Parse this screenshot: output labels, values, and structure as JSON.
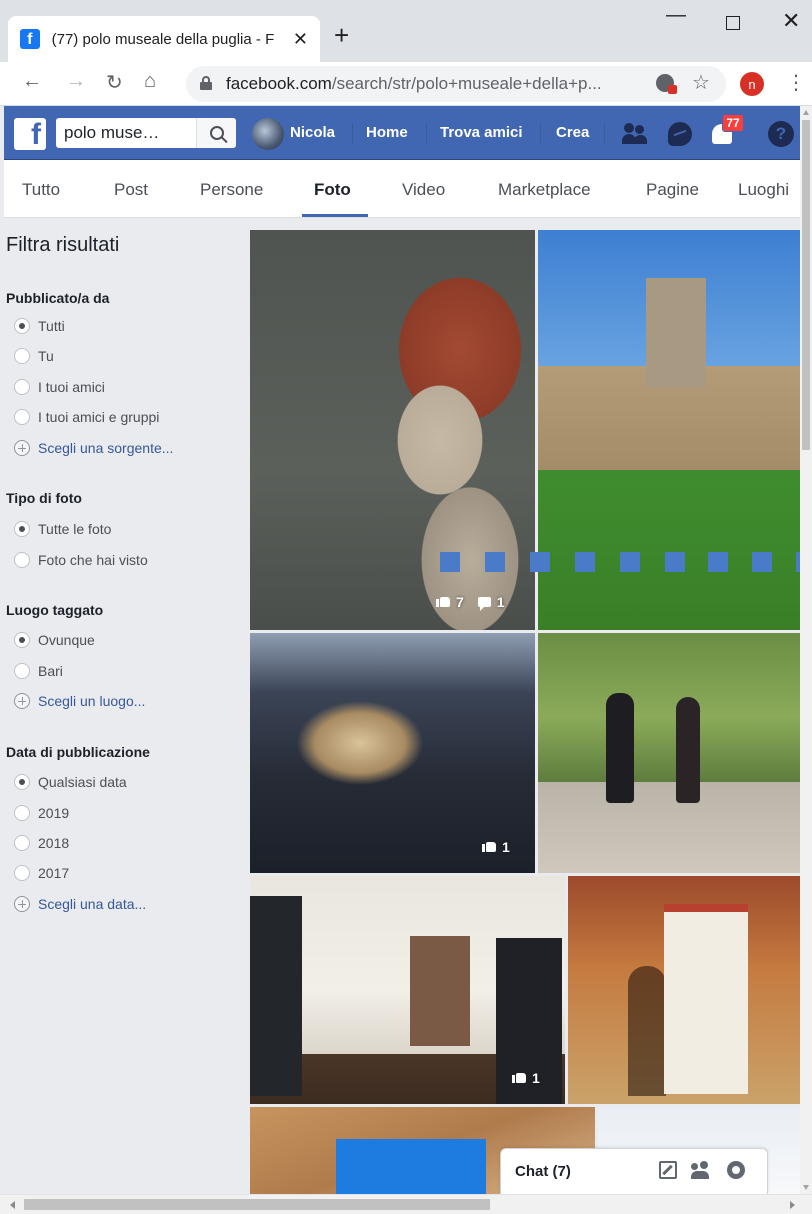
{
  "browser": {
    "tab_title": "(77) polo museale della puglia - F",
    "tab_favicon": "f",
    "close_tab": "✕",
    "new_tab": "+",
    "minimize": "—",
    "close_window": "✕",
    "url_host": "facebook.com",
    "url_path": "/search/str/polo+museale+della+p...",
    "profile_initial": "n",
    "nav_back": "←",
    "nav_forward": "→",
    "nav_reload": "↻",
    "nav_home": "⌂",
    "star": "☆",
    "menu": "⋮"
  },
  "fb_header": {
    "logo": "f",
    "search_value": "polo muse…",
    "user_name": "Nicola",
    "home": "Home",
    "find_friends": "Trova amici",
    "create": "Crea",
    "notifications_count": "77",
    "help": "?"
  },
  "result_tabs": [
    "Tutto",
    "Post",
    "Persone",
    "Foto",
    "Video",
    "Marketplace",
    "Pagine",
    "Luoghi"
  ],
  "active_tab": "Foto",
  "filters": {
    "title": "Filtra risultati",
    "sections": [
      {
        "heading": "Pubblicato/a da",
        "options": [
          {
            "label": "Tutti",
            "checked": true
          },
          {
            "label": "Tu",
            "checked": false
          },
          {
            "label": "I tuoi amici",
            "checked": false
          },
          {
            "label": "I tuoi amici e gruppi",
            "checked": false
          }
        ],
        "link": "Scegli una sorgente..."
      },
      {
        "heading": "Tipo di foto",
        "options": [
          {
            "label": "Tutte le foto",
            "checked": true
          },
          {
            "label": "Foto che hai visto",
            "checked": false
          }
        ]
      },
      {
        "heading": "Luogo taggato",
        "options": [
          {
            "label": "Ovunque",
            "checked": true
          },
          {
            "label": "Bari",
            "checked": false
          }
        ],
        "link": "Scegli un luogo..."
      },
      {
        "heading": "Data di pubblicazione",
        "options": [
          {
            "label": "Qualsiasi data",
            "checked": true
          },
          {
            "label": "2019",
            "checked": false
          },
          {
            "label": "2018",
            "checked": false
          },
          {
            "label": "2017",
            "checked": false
          }
        ],
        "link": "Scegli una data..."
      }
    ]
  },
  "photos": [
    {
      "subject": "Terracotta head in profile",
      "likes": "7",
      "comments": "1"
    },
    {
      "subject": "Castle walls with tower and lawn"
    },
    {
      "subject": "Castle at dusk over city",
      "likes": "1"
    },
    {
      "subject": "Couple cycling along wall"
    },
    {
      "subject": "Museum hall with display cases",
      "likes": "1"
    },
    {
      "subject": "Shrine with vases"
    },
    {
      "subject": "Aerial view with blue pool"
    },
    {
      "subject": "Light photo"
    }
  ],
  "chat": {
    "label": "Chat (7)"
  },
  "colors": {
    "fb_blue": "#4267b2",
    "link_blue": "#365899",
    "badge_red": "#fa3e3e",
    "loader_blue": "#4a7bc8"
  }
}
